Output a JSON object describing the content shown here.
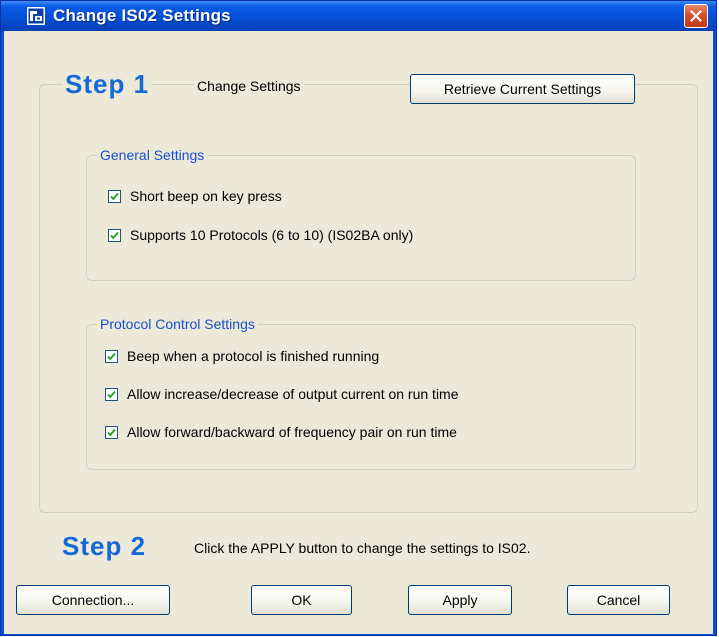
{
  "window": {
    "title": "Change IS02 Settings",
    "icons": {
      "app": "app-logo-icon",
      "close": "close-icon"
    }
  },
  "step1": {
    "label": "Step 1",
    "caption": "Change Settings",
    "retrieve_button": "Retrieve Current Settings"
  },
  "general": {
    "legend": "General Settings",
    "options": [
      {
        "label": "Short beep on key press",
        "checked": true
      },
      {
        "label": "Supports 10 Protocols (6 to 10) (IS02BA only)",
        "checked": true
      }
    ]
  },
  "protocol": {
    "legend": "Protocol Control Settings",
    "options": [
      {
        "label": "Beep when a protocol is finished running",
        "checked": true
      },
      {
        "label": "Allow increase/decrease of output current on run time",
        "checked": true
      },
      {
        "label": "Allow forward/backward of frequency pair on run time",
        "checked": true
      }
    ]
  },
  "step2": {
    "label": "Step 2",
    "instruction": "Click the APPLY button to change the settings to IS02."
  },
  "buttons": {
    "connection": "Connection...",
    "ok": "OK",
    "apply": "Apply",
    "cancel": "Cancel"
  },
  "colors": {
    "title_bar": "#0652d8",
    "step_label": "#1569d6",
    "legend_text": "#1a4fcf",
    "dialog_bg": "#ece9d8",
    "checkmark": "#21a121"
  }
}
